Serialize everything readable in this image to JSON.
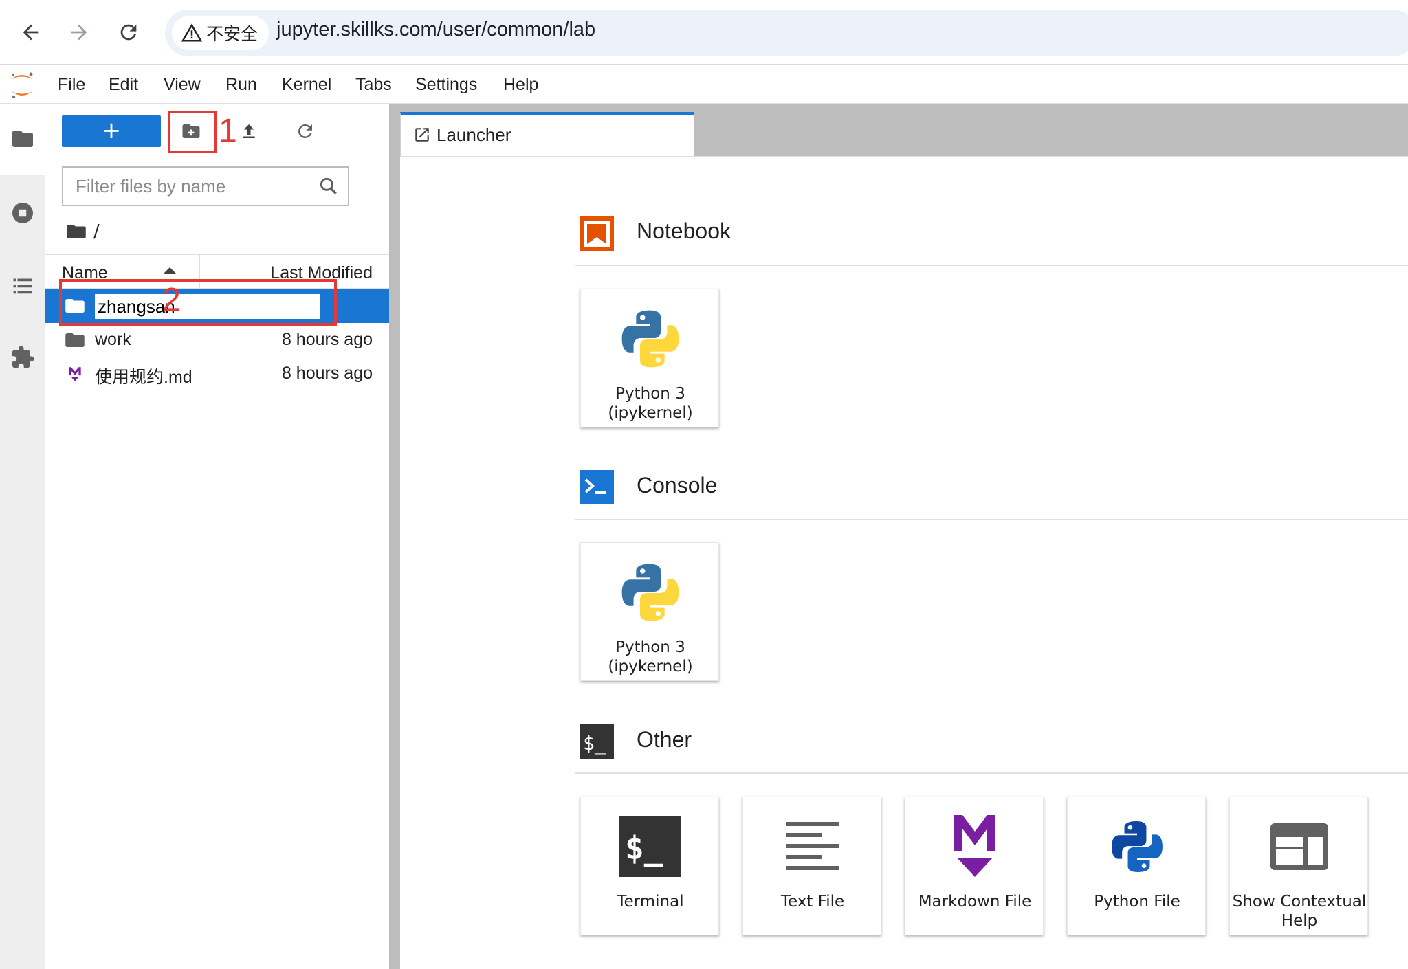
{
  "browser": {
    "security_label": "不安全",
    "url": "jupyter.skillks.com/user/common/lab"
  },
  "menu": {
    "items": [
      "File",
      "Edit",
      "View",
      "Run",
      "Kernel",
      "Tabs",
      "Settings",
      "Help"
    ]
  },
  "filebrowser": {
    "new_label": "+",
    "filter_placeholder": "Filter files by name",
    "breadcrumb": "/",
    "header": {
      "name": "Name",
      "modified": "Last Modified"
    },
    "rename_value": "zhangsan",
    "files": [
      {
        "name": "work",
        "modified": "8 hours ago",
        "icon": "folder-icon"
      },
      {
        "name": "使用规约.md",
        "modified": "8 hours ago",
        "icon": "markdown-icon"
      }
    ]
  },
  "annotations": {
    "step1": "1",
    "step2": "2",
    "color": "#e53935"
  },
  "launcher": {
    "tab_label": "Launcher",
    "sections": {
      "notebook": {
        "title": "Notebook",
        "cards": [
          {
            "label": "Python 3 (ipykernel)"
          }
        ]
      },
      "console": {
        "title": "Console",
        "cards": [
          {
            "label": "Python 3 (ipykernel)"
          }
        ]
      },
      "other": {
        "title": "Other",
        "cards": [
          {
            "label": "Terminal"
          },
          {
            "label": "Text File"
          },
          {
            "label": "Markdown File"
          },
          {
            "label": "Python File"
          },
          {
            "label": "Show Contextual Help"
          }
        ]
      }
    }
  },
  "colors": {
    "accent": "#1976d2",
    "notebook": "#e65100",
    "markdown": "#7b1fa2",
    "terminal": "#333333"
  }
}
